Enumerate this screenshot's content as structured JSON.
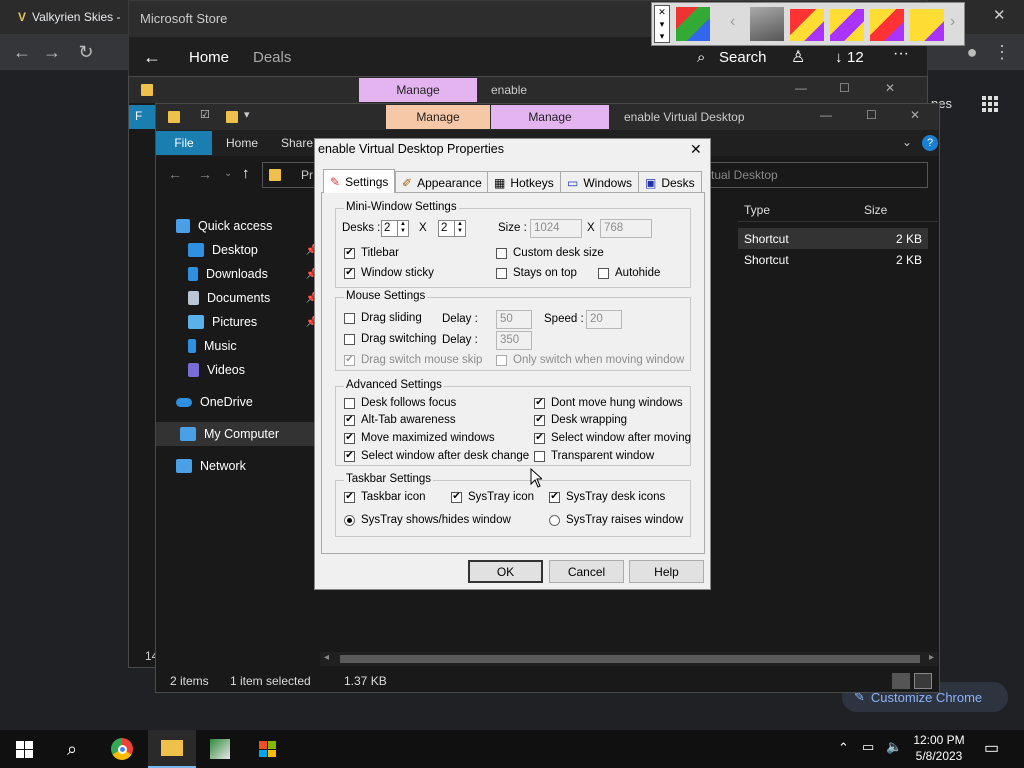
{
  "chrome": {
    "tab_title": "Valkyrien Skies -",
    "customize_label": "Customize Chrome",
    "close_glyph": "✕"
  },
  "store": {
    "title": "Microsoft Store",
    "nav_home": "Home",
    "nav_deals": "Deals",
    "search_label": "Search",
    "downloads_count": "12",
    "more": "···",
    "side_text": "nes"
  },
  "explorer_back": {
    "manage_label": "Manage",
    "tab_title": "enable",
    "first_letter": "F",
    "item_count": "14"
  },
  "explorer": {
    "manage1": "Manage",
    "manage2": "Manage",
    "title": "enable Virtual Desktop",
    "menu_file": "File",
    "menu_home": "Home",
    "menu_share": "Share",
    "addr_prefix": "Pr",
    "search_placeholder": "rtual Desktop",
    "nav": [
      {
        "label": "Quick access",
        "icon": "star-icon",
        "color": "#4aa0e6"
      },
      {
        "label": "Desktop",
        "icon": "desktop-icon",
        "color": "#2f8fe0",
        "pin": true
      },
      {
        "label": "Downloads",
        "icon": "download-icon",
        "color": "#2f8fe0",
        "pin": true
      },
      {
        "label": "Documents",
        "icon": "document-icon",
        "color": "#b8c6d6",
        "pin": true
      },
      {
        "label": "Pictures",
        "icon": "picture-icon",
        "color": "#5ab0e8",
        "pin": true
      },
      {
        "label": "Music",
        "icon": "music-icon",
        "color": "#2f8fe0"
      },
      {
        "label": "Videos",
        "icon": "video-icon",
        "color": "#7a6cd6"
      },
      {
        "label": "OneDrive",
        "icon": "cloud-icon",
        "color": "#2f8fe0"
      },
      {
        "label": "My Computer",
        "icon": "computer-icon",
        "color": "#4aa0e6"
      },
      {
        "label": "Network",
        "icon": "network-icon",
        "color": "#4aa0e6"
      }
    ],
    "col_type": "Type",
    "col_size": "Size",
    "files": [
      {
        "type": "Shortcut",
        "size": "2 KB"
      },
      {
        "type": "Shortcut",
        "size": "2 KB"
      }
    ],
    "status_items": "2 items",
    "status_selected": "1 item selected",
    "status_size": "1.37 KB"
  },
  "dialog": {
    "title": "enable Virtual Desktop Properties",
    "tabs": [
      "Settings",
      "Appearance",
      "Hotkeys",
      "Windows",
      "Desks"
    ],
    "mini": {
      "title": "Mini-Window Settings",
      "desks_label": "Desks :",
      "desks_x": "2",
      "x_sep": "X",
      "desks_y": "2",
      "size_label": "Size :",
      "size_w": "1024",
      "size_h": "768",
      "titlebar": "Titlebar",
      "window_sticky": "Window sticky",
      "custom_desk_size": "Custom desk size",
      "stays_on_top": "Stays on top",
      "autohide": "Autohide"
    },
    "mouse": {
      "title": "Mouse Settings",
      "drag_sliding": "Drag sliding",
      "drag_switching": "Drag switching",
      "drag_switch_skip": "Drag switch mouse skip",
      "only_switch": "Only switch when moving window",
      "delay_label": "Delay :",
      "delay1": "50",
      "delay2": "350",
      "speed_label": "Speed :",
      "speed": "20"
    },
    "advanced": {
      "title": "Advanced Settings",
      "desk_follows_focus": "Desk follows focus",
      "alt_tab": "Alt-Tab awareness",
      "move_maximized": "Move maximized windows",
      "select_after_change": "Select window after desk change",
      "dont_move_hung": "Dont move hung windows",
      "desk_wrapping": "Desk wrapping",
      "select_after_moving": "Select window after moving",
      "transparent": "Transparent window"
    },
    "taskbar": {
      "title": "Taskbar Settings",
      "taskbar_icon": "Taskbar icon",
      "systray_icon": "SysTray icon",
      "systray_desk_icons": "SysTray desk icons",
      "shows_hides": "SysTray shows/hides window",
      "raises": "SysTray raises window"
    },
    "ok": "OK",
    "cancel": "Cancel",
    "help": "Help",
    "check": "✔",
    "close": "✕"
  },
  "taskbar": {
    "time": "12:00 PM",
    "date": "5/8/2023"
  }
}
